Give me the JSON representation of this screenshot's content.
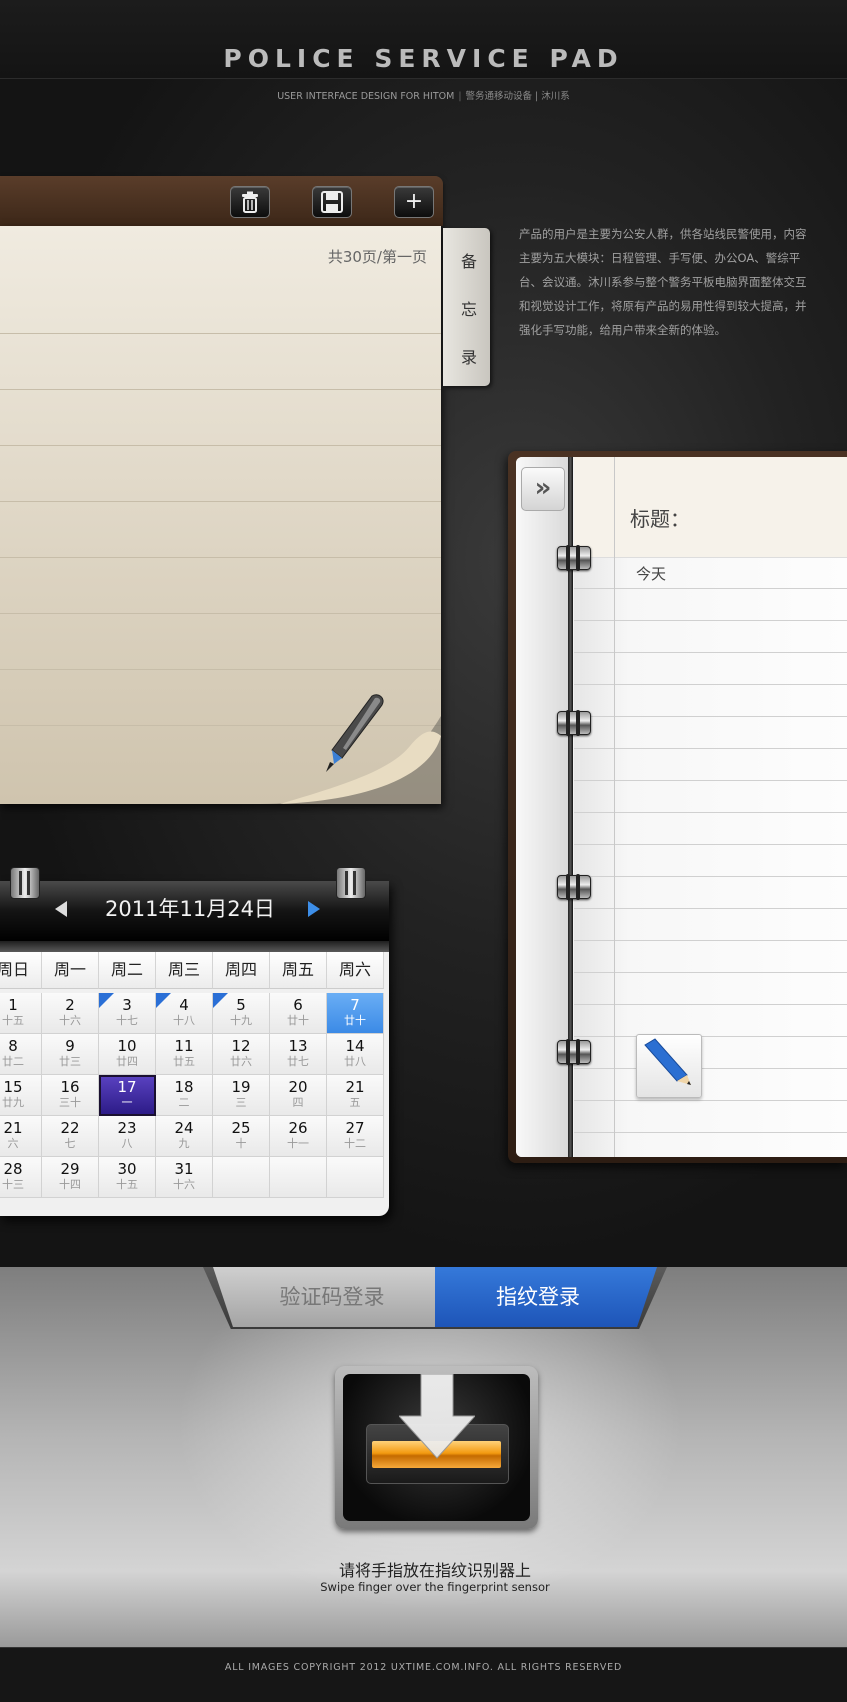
{
  "header": {
    "title": "POLICE SERVICE PAD",
    "subtitle_en": "USER INTERFACE DESIGN FOR HITOM",
    "subtitle_cn": "警务通移动设备 | 沐川系"
  },
  "description": "产品的用户是主要为公安人群，供各站线民警使用，内容主要为五大模块：日程管理、手写便、办公OA、警综平台、会议通。沐川系参与整个警务平板电脑界面整体交互和视觉设计工作，将原有产品的易用性得到较大提高，并强化手写功能，给用户带来全新的体验。",
  "memo": {
    "toolbar": {
      "icons": [
        "trash-icon",
        "save-icon",
        "plus-icon"
      ],
      "plus_label": "+"
    },
    "page_indicator": "共30页/第一页",
    "side_tab": {
      "char1": "备",
      "char2": "忘",
      "char3": "录"
    }
  },
  "notebook": {
    "collapse_label": "»",
    "title_label": "标题：",
    "first_line": "今天",
    "pencil_icon": "pencil-icon"
  },
  "calendar": {
    "title": "2011年11月24日",
    "weekdays": [
      "周日",
      "周一",
      "周二",
      "周三",
      "周四",
      "周五",
      "周六"
    ],
    "days": [
      {
        "d": "1",
        "l": "十五"
      },
      {
        "d": "2",
        "l": "十六"
      },
      {
        "d": "3",
        "l": "十七",
        "flag": true
      },
      {
        "d": "4",
        "l": "十八",
        "flag": true
      },
      {
        "d": "5",
        "l": "十九",
        "flag": true
      },
      {
        "d": "6",
        "l": "廿十"
      },
      {
        "d": "7",
        "l": "廿十",
        "selected": true
      },
      {
        "d": "8",
        "l": "廿二"
      },
      {
        "d": "9",
        "l": "廿三"
      },
      {
        "d": "10",
        "l": "廿四"
      },
      {
        "d": "11",
        "l": "廿五"
      },
      {
        "d": "12",
        "l": "廿六"
      },
      {
        "d": "13",
        "l": "廿七"
      },
      {
        "d": "14",
        "l": "廿八"
      },
      {
        "d": "15",
        "l": "廿九"
      },
      {
        "d": "16",
        "l": "三十"
      },
      {
        "d": "17",
        "l": "一",
        "today": true
      },
      {
        "d": "18",
        "l": "二"
      },
      {
        "d": "19",
        "l": "三"
      },
      {
        "d": "20",
        "l": "四"
      },
      {
        "d": "21",
        "l": "五"
      },
      {
        "d": "21",
        "l": "六"
      },
      {
        "d": "22",
        "l": "七"
      },
      {
        "d": "23",
        "l": "八"
      },
      {
        "d": "24",
        "l": "九"
      },
      {
        "d": "25",
        "l": "十"
      },
      {
        "d": "26",
        "l": "十一"
      },
      {
        "d": "27",
        "l": "十二"
      },
      {
        "d": "28",
        "l": "十三"
      },
      {
        "d": "29",
        "l": "十四"
      },
      {
        "d": "30",
        "l": "十五"
      },
      {
        "d": "31",
        "l": "十六"
      },
      {
        "d": "",
        "l": ""
      },
      {
        "d": "",
        "l": ""
      },
      {
        "d": "",
        "l": ""
      }
    ],
    "colors": {
      "flag": "#2a6fd6",
      "selected": "#3b8ae6",
      "today": "#2b1a86"
    }
  },
  "login": {
    "tab_sms": "验证码登录",
    "tab_fingerprint": "指纹登录",
    "hint_cn": "请将手指放在指纹识别器上",
    "hint_en": "Swipe finger over the fingerprint sensor",
    "accent": "#f39a10"
  },
  "footer": {
    "copyright": "ALL IMAGES  COPYRIGHT 2012 UXTIME.COM.INFO. ALL RIGHTS RESERVED"
  }
}
